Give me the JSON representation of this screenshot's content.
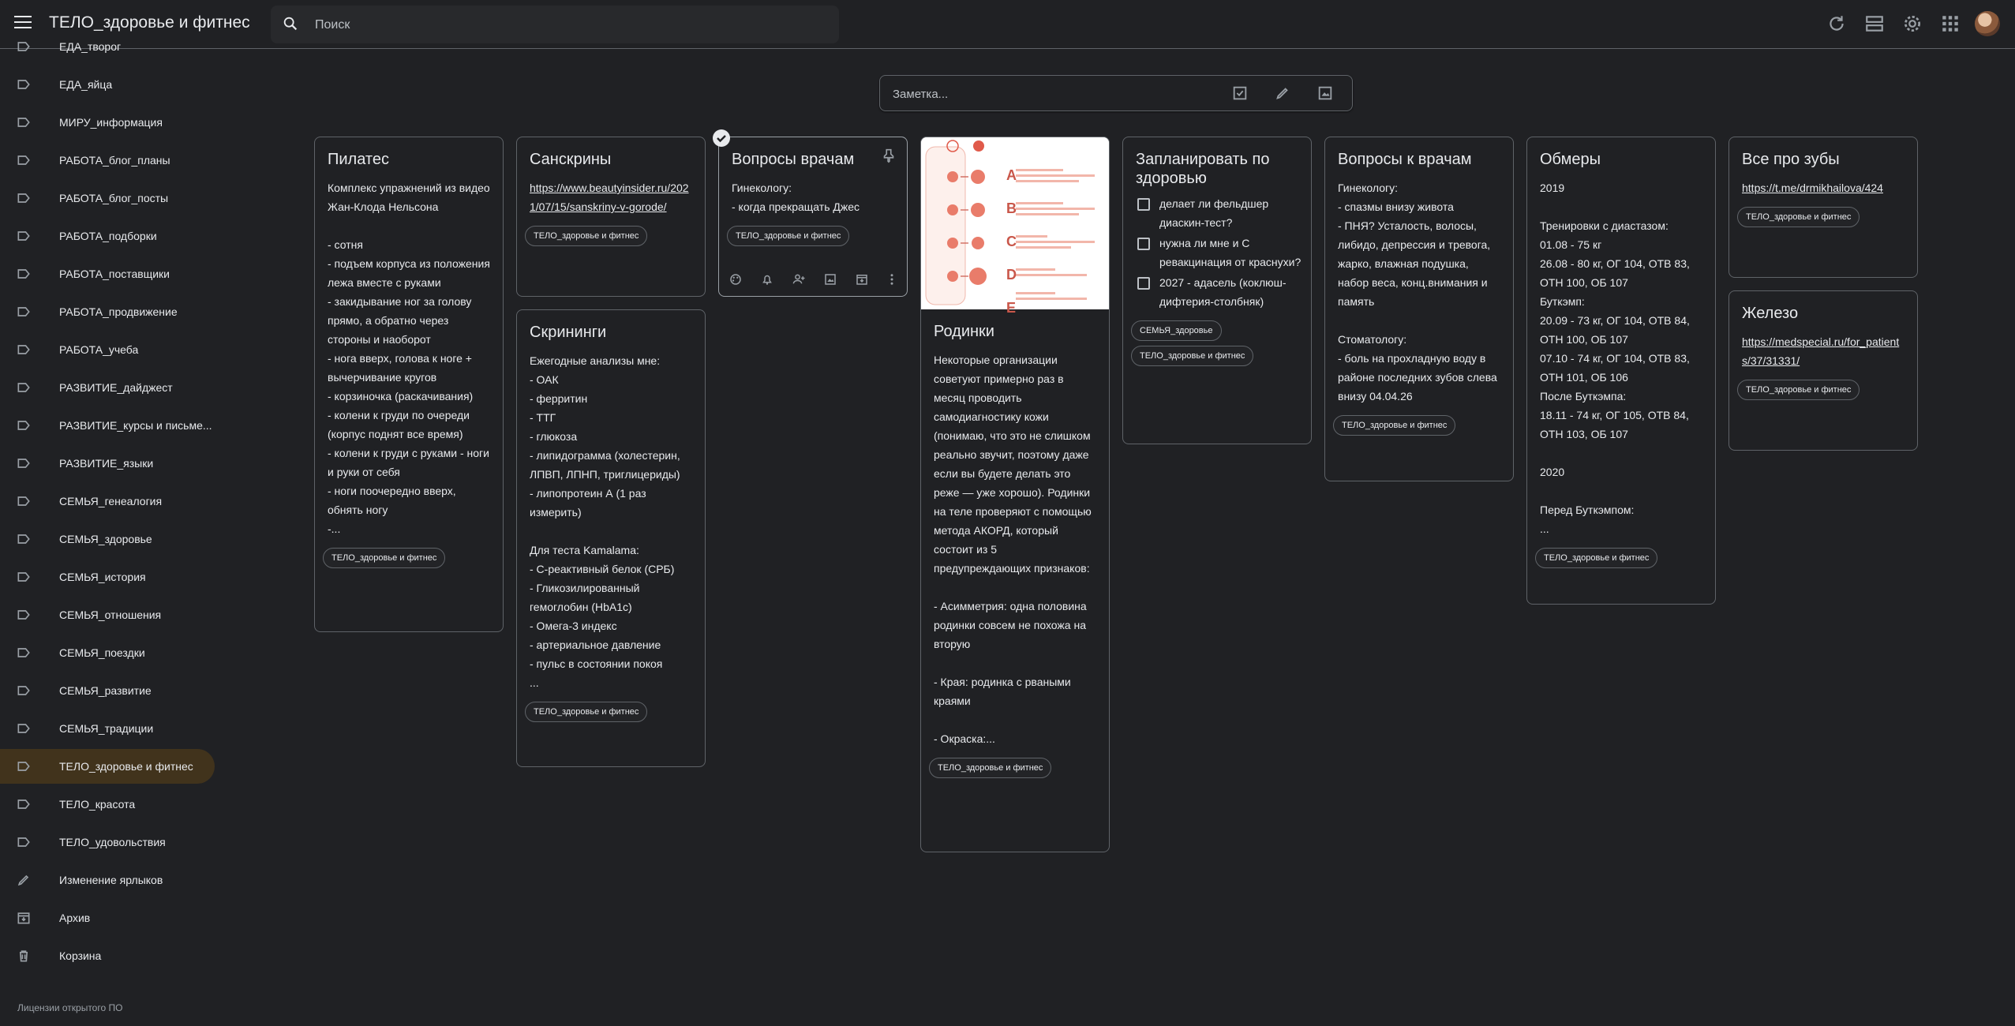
{
  "header": {
    "menu_icon": "menu-icon",
    "title": "ТЕЛО_здоровье и фитнес",
    "search_placeholder": "Поиск",
    "icons": [
      "refresh-icon",
      "list-view-icon",
      "settings-icon",
      "apps-icon"
    ]
  },
  "sidebar": {
    "items": [
      {
        "label": "ЕДА_творог",
        "icon": "label-icon"
      },
      {
        "label": "ЕДА_яйца",
        "icon": "label-icon"
      },
      {
        "label": "МИРУ_информация",
        "icon": "label-icon"
      },
      {
        "label": "РАБОТА_блог_планы",
        "icon": "label-icon"
      },
      {
        "label": "РАБОТА_блог_посты",
        "icon": "label-icon"
      },
      {
        "label": "РАБОТА_подборки",
        "icon": "label-icon"
      },
      {
        "label": "РАБОТА_поставщики",
        "icon": "label-icon"
      },
      {
        "label": "РАБОТА_продвижение",
        "icon": "label-icon"
      },
      {
        "label": "РАБОТА_учеба",
        "icon": "label-icon"
      },
      {
        "label": "РАЗВИТИЕ_дайджест",
        "icon": "label-icon"
      },
      {
        "label": "РАЗВИТИЕ_курсы и письме...",
        "icon": "label-icon"
      },
      {
        "label": "РАЗВИТИЕ_языки",
        "icon": "label-icon"
      },
      {
        "label": "СЕМЬЯ_генеалогия",
        "icon": "label-icon"
      },
      {
        "label": "СЕМЬЯ_здоровье",
        "icon": "label-icon"
      },
      {
        "label": "СЕМЬЯ_история",
        "icon": "label-icon"
      },
      {
        "label": "СЕМЬЯ_отношения",
        "icon": "label-icon"
      },
      {
        "label": "СЕМЬЯ_поездки",
        "icon": "label-icon"
      },
      {
        "label": "СЕМЬЯ_развитие",
        "icon": "label-icon"
      },
      {
        "label": "СЕМЬЯ_традиции",
        "icon": "label-icon"
      },
      {
        "label": "ТЕЛО_здоровье и фитнес",
        "icon": "label-icon",
        "active": true
      },
      {
        "label": "ТЕЛО_красота",
        "icon": "label-icon"
      },
      {
        "label": "ТЕЛО_удовольствия",
        "icon": "label-icon"
      },
      {
        "label": "Изменение ярлыков",
        "icon": "edit-icon"
      },
      {
        "label": "Архив",
        "icon": "archive-icon"
      },
      {
        "label": "Корзина",
        "icon": "trash-icon"
      }
    ],
    "footer": "Лицензии открытого ПО"
  },
  "take_note": {
    "placeholder": "Заметка...",
    "icons": [
      "checkbox-icon",
      "brush-icon",
      "image-icon"
    ]
  },
  "notes": {
    "pilates": {
      "title": "Пилатес",
      "body": "Комплекс упражнений из видео Жан-Клода Нельсона\n\n- сотня\n- подъем корпуса из положения лежа вместе с руками\n- закидывание ног за голову прямо, а обратно через стороны и наоборот\n- нога вверх, голова к ноге + вычерчивание кругов\n- корзиночка (раскачивания)\n- колени к груди по очереди (корпус поднят все время)\n- колени к груди с руками - ноги и руки от себя\n- ноги поочередно вверх, обнять ногу\n-...",
      "label": "ТЕЛО_здоровье и фитнес"
    },
    "sunscreens": {
      "title": "Санскрины",
      "link": "https://www.beautyinsider.ru/2021/07/15/sanskriny-v-gorode/",
      "label": "ТЕЛО_здоровье и фитнес"
    },
    "screenings": {
      "title": "Скрининги",
      "body": "Ежегодные анализы мне:\n- ОАК\n- ферритин\n- ТТГ\n- глюкоза\n- липидограмма (холестерин, ЛПВП, ЛПНП, триглицериды)\n- липопротеин А (1 раз измерить)\n\nДля теста Kamalama:\n- С-реактивный белок (СРБ)\n- Гликозилированный гемоглобин (HbA1c)\n- Омега-3 индекс\n- артериальное давление\n- пульс в состоянии покоя\n...",
      "label": "ТЕЛО_здоровье и фитнес"
    },
    "doctor_questions": {
      "title": "Вопросы врачам",
      "body": "Гинекологу:\n- когда прекращать Джес",
      "label": "ТЕЛО_здоровье и фитнес",
      "toolbar_icons": [
        "palette-icon",
        "reminder-bell-icon",
        "collaborator-icon",
        "image-icon",
        "archive-icon",
        "more-vert-icon"
      ]
    },
    "moles": {
      "title": "Родинки",
      "image_letters": [
        "A",
        "B",
        "C",
        "D",
        "E"
      ],
      "body": "Некоторые организации советуют примерно раз в месяц проводить самодиагностику кожи (понимаю, что это не слишком реально звучит, поэтому даже если вы будете делать это реже — уже хорошо). Родинки на теле проверяют с помощью метода АКОРД, который состоит из 5 предупреждающих признаков:\n\n- Асимметрия: одна половина родинки совсем не похожа на вторую\n\n- Края: родинка с рваными краями\n\n- Окраска:...",
      "label": "ТЕЛО_здоровье и фитнес"
    },
    "plan_health": {
      "title": "Запланировать по здоровью",
      "checklist": [
        "делает ли фельдшер диаскин-тест?",
        "нужна ли мне и С ревакцинация от краснухи?",
        "2027 - адасель (коклюш-дифтерия-столбняк)"
      ],
      "labels": [
        "СЕМЬЯ_здоровье",
        "ТЕЛО_здоровье и фитнес"
      ]
    },
    "doctor_questions2": {
      "title": "Вопросы к врачам",
      "body": "Гинекологу:\n- спазмы внизу живота\n- ПНЯ? Усталость, волосы, либидо, депрессия и тревога, жарко, влажная подушка, набор веса, конц.внимания и память\n\nСтоматологу:\n- боль на прохладную воду в районе последних зубов слева внизу 04.04.26",
      "label": "ТЕЛО_здоровье и фитнес"
    },
    "measurements": {
      "title": "Обмеры",
      "body": "2019\n\nТренировки с диастазом:\n01.08 - 75 кг\n26.08 - 80 кг, ОГ 104, ОТВ 83, ОТН 100, ОБ 107\nБуткэмп:\n20.09 - 73 кг, ОГ 104, ОТВ 84, ОТН 100, ОБ 107\n07.10 - 74 кг, ОГ 104, ОТВ 83, ОТН 101, ОБ 106\nПосле Буткэмпа:\n18.11 - 74 кг, ОГ 105, ОТВ 84, ОТН 103, ОБ 107\n\n2020\n\nПеред Буткэмпом:\n...",
      "label": "ТЕЛО_здоровье и фитнес"
    },
    "teeth": {
      "title": "Все про зубы",
      "link": "https://t.me/drmikhailova/424",
      "label": "ТЕЛО_здоровье и фитнес"
    },
    "iron": {
      "title": "Железо",
      "link": "https://medspecial.ru/for_patients/37/31331/",
      "label": "ТЕЛО_здоровье и фитнес"
    }
  }
}
